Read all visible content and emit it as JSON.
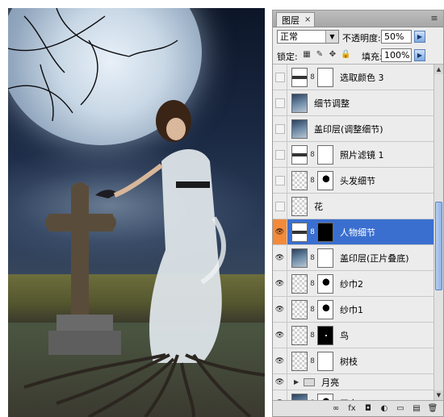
{
  "panel": {
    "tab_label": "图层",
    "tab_close": "×",
    "menu_icon": "≡",
    "blend_mode": "正常",
    "opacity_label": "不透明度:",
    "opacity_value": "50%",
    "lock_label": "锁定:",
    "fill_label": "填充:",
    "fill_value": "100%"
  },
  "icons": {
    "dropdown": "▼",
    "spin": "▶",
    "lock_transparent": "▦",
    "lock_paint": "✎",
    "lock_move": "✥",
    "lock_all": "🔒",
    "eye": "👁",
    "link": "8",
    "group_closed": "▶",
    "scroll_up": "▲",
    "scroll_down": "▼"
  },
  "layers": [
    {
      "name": "选取颜色 3",
      "visible": false,
      "thumb": "adjust",
      "mask": "mask-white"
    },
    {
      "name": "细节调整",
      "visible": false,
      "thumb": "photo",
      "mask": null
    },
    {
      "name": "盖印层(调整细节)",
      "visible": false,
      "thumb": "photo",
      "mask": null
    },
    {
      "name": "照片滤镜 1",
      "visible": false,
      "thumb": "adjust",
      "mask": "mask-white"
    },
    {
      "name": "头发细节",
      "visible": false,
      "thumb": "checker",
      "mask": "mask-shape"
    },
    {
      "name": "花",
      "visible": false,
      "thumb": "checker",
      "mask": null
    },
    {
      "name": "人物细节",
      "visible": true,
      "thumb": "adjust",
      "mask": "mask-black",
      "selected": true
    },
    {
      "name": "盖印层(正片叠底)",
      "visible": true,
      "thumb": "photo",
      "mask": "mask-white"
    },
    {
      "name": "纱巾2",
      "visible": true,
      "thumb": "checker",
      "mask": "mask-shape"
    },
    {
      "name": "纱巾1",
      "visible": true,
      "thumb": "checker",
      "mask": "mask-shape"
    },
    {
      "name": "鸟",
      "visible": true,
      "thumb": "checker",
      "mask": "mask-dot"
    },
    {
      "name": "树枝",
      "visible": true,
      "thumb": "checker",
      "mask": "mask-white"
    },
    {
      "name": "月亮",
      "visible": true,
      "group": true
    },
    {
      "name": "天空",
      "visible": true,
      "thumb": "photo",
      "mask": "mask-shape"
    }
  ],
  "footer": {
    "link_layers": "∞",
    "fx": "fx",
    "add_mask": "◘",
    "adjustment": "◐",
    "new_group": "▭",
    "new_layer": "▤",
    "delete": "🗑"
  }
}
